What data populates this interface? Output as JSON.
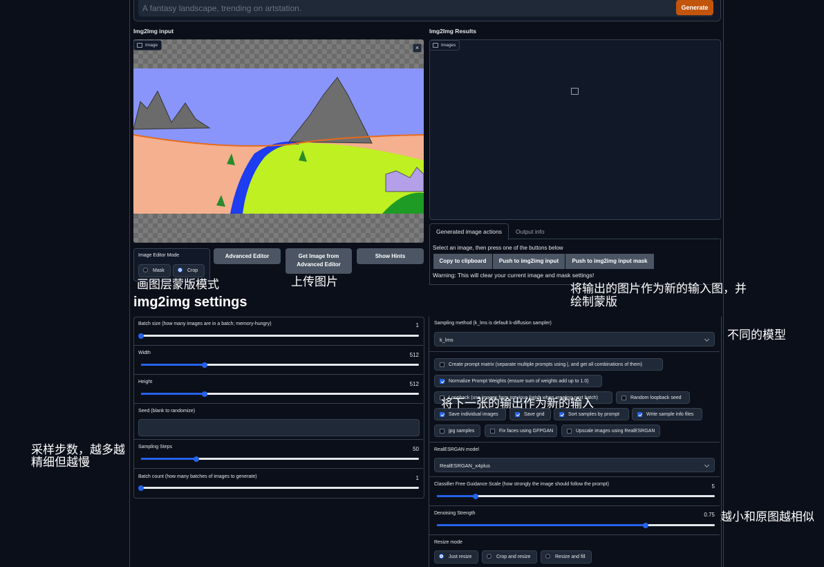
{
  "prompt": {
    "placeholder": "A fantasy landscape, trending on artstation.",
    "generate_label": "Generate"
  },
  "input_panel": {
    "title": "Img2Img input",
    "image_tag": "Image",
    "close_icon": "close-icon",
    "editor_mode_label": "Image Editor Mode",
    "mode_options": [
      "Mask",
      "Crop"
    ],
    "mode_selected": "Crop",
    "advanced_editor_label": "Advanced Editor",
    "get_image_label_1": "Get Image from",
    "get_image_label_2": "Advanced Editor",
    "show_hints_label": "Show Hints"
  },
  "results_panel": {
    "title": "Img2Img Results",
    "images_tag": "Images",
    "tabs": [
      "Generated image actions",
      "Output info"
    ],
    "active_tab": "Generated image actions",
    "instruction": "Select an image, then press one of the buttons below",
    "buttons": [
      "Copy to clipboard",
      "Push to img2img input",
      "Push to img2img input mask"
    ],
    "warning": "Warning: This will clear your current image and mask settings!"
  },
  "annotations": {
    "mask_mode": "画图层蒙版模式",
    "upload": "上传图片",
    "push_output_1": "将输出的图片作为新的输入图，并",
    "push_output_2": "绘制蒙版",
    "different_model": "不同的模型",
    "loopback": "将下一张的输出作为新的输入",
    "steps_1": "采样步数，越多越",
    "steps_2": "精细但越慢",
    "denoise": "越小和原图越相似"
  },
  "settings": {
    "title": "img2img settings",
    "sliders": [
      {
        "label": "Batch size (how many images are in a batch; memory-hungry)",
        "value": "1",
        "fraction": 0.0
      },
      {
        "label": "Width",
        "value": "512",
        "fraction": 0.23
      },
      {
        "label": "Height",
        "value": "512",
        "fraction": 0.23
      },
      {
        "label": "Sampling Steps",
        "value": "50",
        "fraction": 0.2
      },
      {
        "label": "Batch count (how many batches of images to generate)",
        "value": "1",
        "fraction": 0.0
      }
    ],
    "seed_label": "Seed (blank to randomize)",
    "seed_value": ""
  },
  "right_settings": {
    "sampler_label": "Sampling method (k_lms is default k-diffusion sampler)",
    "sampler_value": "k_lms",
    "checkboxes": [
      {
        "label": "Create prompt matrix (separate multiple prompts using |, and get all combinations of them)",
        "checked": false
      },
      {
        "label": "Normalize Prompt Weights (ensure sum of weights add up to 1.0)",
        "checked": true
      },
      {
        "label": "Loopback (use images from previous batch when creating next batch)",
        "checked": false
      },
      {
        "label": "Random loopback seed",
        "checked": false
      },
      {
        "label": "Save individual images",
        "checked": true
      },
      {
        "label": "Save grid",
        "checked": true
      },
      {
        "label": "Sort samples by prompt",
        "checked": true
      },
      {
        "label": "Write sample info files",
        "checked": true
      },
      {
        "label": "jpg samples",
        "checked": false
      },
      {
        "label": "Fix faces using GFPGAN",
        "checked": false
      },
      {
        "label": "Upscale images using RealESRGAN",
        "checked": false
      }
    ],
    "realesrgan_label": "RealESRGAN model",
    "realesrgan_value": "RealESRGAN_x4plus",
    "cfg_label": "Classifier Free Guidance Scale (how strongly the image should follow the prompt)",
    "cfg_value": "5",
    "cfg_fraction": 0.14,
    "denoise_label": "Denoising Strength",
    "denoise_value": "0.75",
    "denoise_fraction": 0.75,
    "resize_label": "Resize mode",
    "resize_options": [
      "Just resize",
      "Crop and resize",
      "Resize and fill"
    ],
    "resize_selected": "Just resize"
  }
}
